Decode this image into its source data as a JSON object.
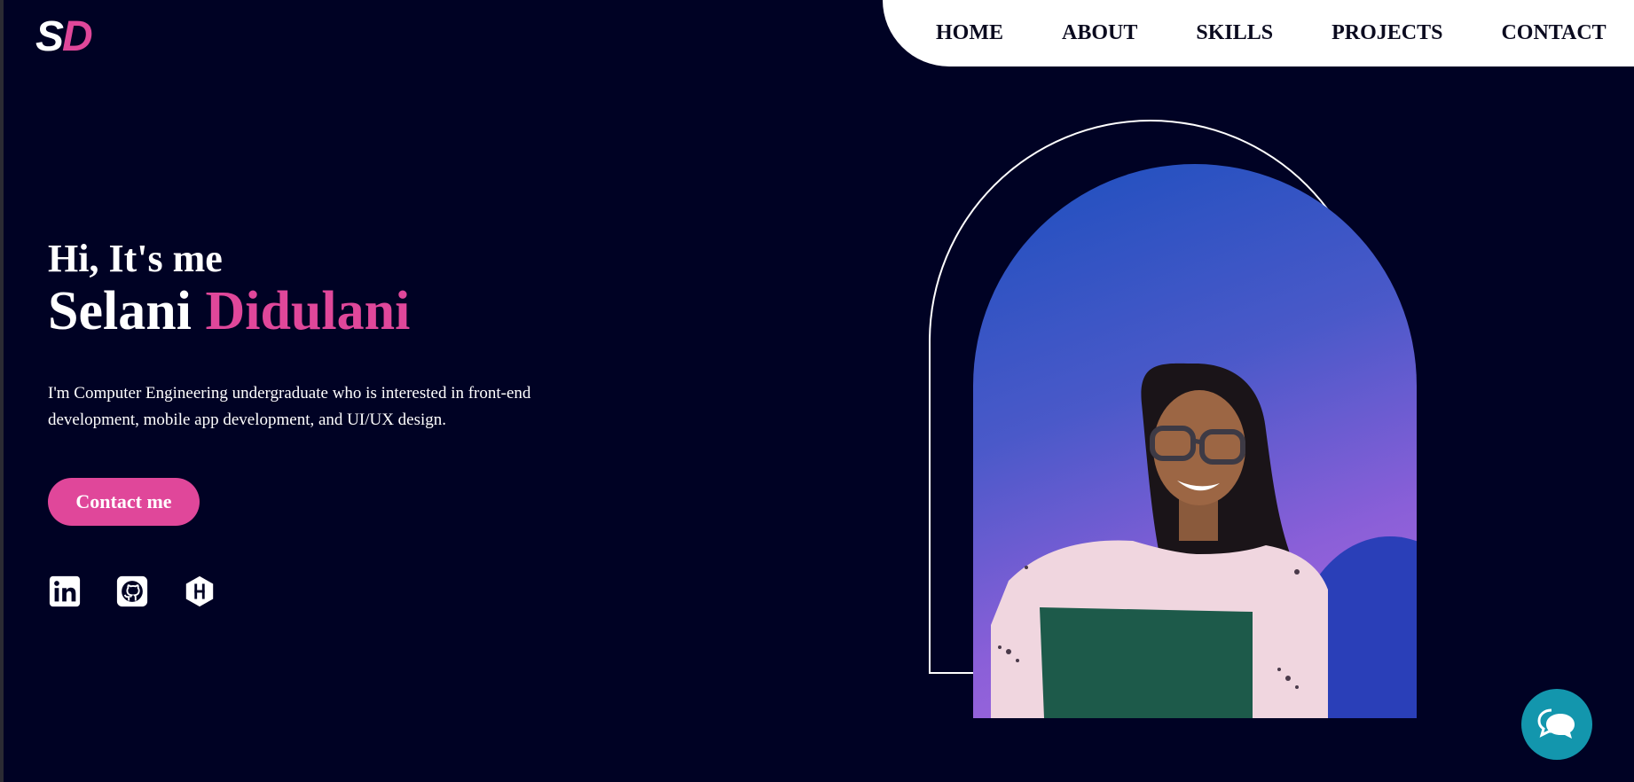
{
  "logo": {
    "first": "S",
    "second": "D"
  },
  "nav": [
    {
      "label": "HOME"
    },
    {
      "label": "ABOUT"
    },
    {
      "label": "SKILLS"
    },
    {
      "label": "PROJECTS"
    },
    {
      "label": "CONTACT"
    }
  ],
  "hero": {
    "greeting": "Hi, It's me",
    "first_name": "Selani",
    "last_name": "Didulani",
    "description": "I'm Computer Engineering undergraduate who is interested in front-end development, mobile app development, and UI/UX design.",
    "cta": "Contact me"
  },
  "socials": [
    {
      "icon": "linkedin-icon"
    },
    {
      "icon": "github-icon"
    },
    {
      "icon": "hashnode-icon"
    }
  ],
  "colors": {
    "background": "#000224",
    "accent": "#e0479a",
    "chat": "#1396ad"
  }
}
